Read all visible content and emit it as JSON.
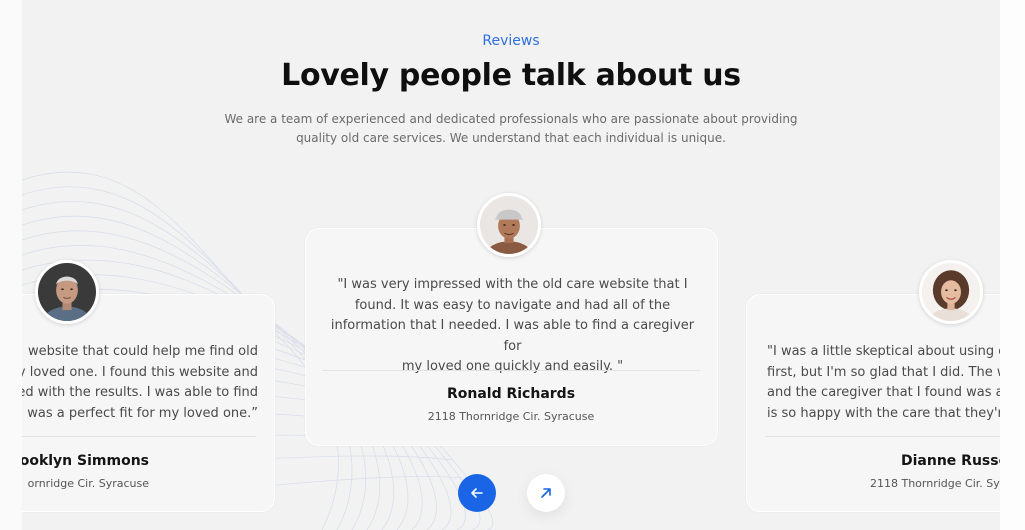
{
  "section": {
    "eyebrow": "Reviews",
    "title": "Lovely people talk about us",
    "subtitle_line1": "We are a team of experienced and dedicated professionals who are passionate about providing",
    "subtitle_line2": "quality old care services. We understand that each individual is unique."
  },
  "reviews": [
    {
      "lines": [
        "website that could help me find old",
        "ny loved one. I found this website and",
        "ed with the results. I was able to find",
        "was a perfect fit for my loved one.”"
      ],
      "name": "ooklyn Simmons",
      "address": "ornridge Cir. Syracuse"
    },
    {
      "lines": [
        "\"I was very impressed with the old care website that I",
        "found. It was easy to navigate and had all of the",
        "information that I needed. I was able to find a caregiver for",
        "my loved one quickly and easily. \""
      ],
      "name": "Ronald Richards",
      "address": "2118 Thornridge Cir. Syracuse"
    },
    {
      "lines": [
        "\"I was a little skeptical about using o",
        "first, but I'm so glad that I did. The we",
        "and the caregiver that I found was a",
        "is so happy with the care that they're"
      ],
      "name": "Dianne Russel",
      "address": "2118 Thornridge Cir. Syr"
    }
  ],
  "nav": {
    "prev_icon": "arrow-left-icon",
    "next_icon": "arrow-up-right-icon",
    "accent": "#1a64e6"
  },
  "colors": {
    "background": "#f2f2f2",
    "eyebrow": "#2f6fe0",
    "title": "#0f0f0f"
  }
}
